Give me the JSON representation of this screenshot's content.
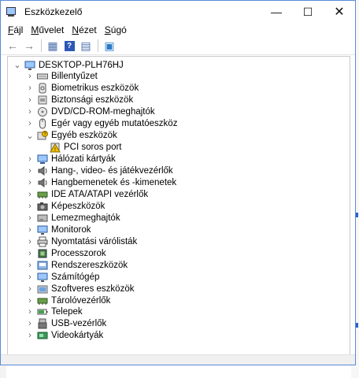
{
  "window": {
    "title": "Eszközkezelő",
    "controls": {
      "minimize": "—",
      "maximize": "☐",
      "close": "✕"
    }
  },
  "menu": [
    {
      "label": "Fájl",
      "accel": "F",
      "rest": "ájl"
    },
    {
      "label": "Művelet",
      "accel": "M",
      "rest": "űvelet"
    },
    {
      "label": "Nézet",
      "accel": "N",
      "rest": "ézet"
    },
    {
      "label": "Súgó",
      "accel": "S",
      "rest": "úgó"
    }
  ],
  "toolbar": [
    {
      "name": "back-icon",
      "glyph": "←",
      "color": "#7a7a7a"
    },
    {
      "name": "forward-icon",
      "glyph": "→",
      "color": "#7a7a7a"
    },
    {
      "name": "properties-icon",
      "glyph": "▦",
      "color": "#4a6ea9"
    },
    {
      "name": "help-icon",
      "glyph": "?",
      "color": "#2b57b5"
    },
    {
      "name": "view-icon",
      "glyph": "▤",
      "color": "#4a6ea9"
    },
    {
      "name": "scan-hardware-icon",
      "glyph": "▣",
      "color": "#2a7ac9"
    }
  ],
  "tree": {
    "root": "DESKTOP-PLH76HJ",
    "items": [
      {
        "label": "Billentyűzet",
        "icon": "keyboard-icon",
        "expanded": false
      },
      {
        "label": "Biometrikus eszközök",
        "icon": "fingerprint-icon",
        "expanded": false
      },
      {
        "label": "Biztonsági eszközök",
        "icon": "security-device-icon",
        "expanded": false
      },
      {
        "label": "DVD/CD-ROM-meghajtók",
        "icon": "dvd-drive-icon",
        "expanded": false
      },
      {
        "label": "Egér vagy egyéb mutatóeszköz",
        "icon": "mouse-icon",
        "expanded": false
      },
      {
        "label": "Egyéb eszközök",
        "icon": "unknown-device-icon",
        "expanded": true,
        "children": [
          {
            "label": "PCI soros port",
            "icon": "warning-device-icon"
          }
        ]
      },
      {
        "label": "Hálózati kártyák",
        "icon": "network-adapter-icon",
        "expanded": false
      },
      {
        "label": "Hang-, video- és játékvezérlők",
        "icon": "sound-icon",
        "expanded": false
      },
      {
        "label": "Hangbemenetek és -kimenetek",
        "icon": "audio-io-icon",
        "expanded": false
      },
      {
        "label": "IDE ATA/ATAPI vezérlők",
        "icon": "ide-controller-icon",
        "expanded": false
      },
      {
        "label": "Képeszközök",
        "icon": "camera-icon",
        "expanded": false
      },
      {
        "label": "Lemezmeghajtók",
        "icon": "disk-drive-icon",
        "expanded": false
      },
      {
        "label": "Monitorok",
        "icon": "monitor-icon",
        "expanded": false
      },
      {
        "label": "Nyomtatási várólisták",
        "icon": "printer-icon",
        "expanded": false
      },
      {
        "label": "Processzorok",
        "icon": "processor-icon",
        "expanded": false
      },
      {
        "label": "Rendszereszközök",
        "icon": "system-device-icon",
        "expanded": false
      },
      {
        "label": "Számítógép",
        "icon": "computer-icon",
        "expanded": false
      },
      {
        "label": "Szoftveres eszközök",
        "icon": "software-device-icon",
        "expanded": false
      },
      {
        "label": "Tárolóvezérlők",
        "icon": "storage-controller-icon",
        "expanded": false
      },
      {
        "label": "Telepek",
        "icon": "battery-icon",
        "expanded": false
      },
      {
        "label": "USB-vezérlők",
        "icon": "usb-icon",
        "expanded": false
      },
      {
        "label": "Videokártyák",
        "icon": "display-adapter-icon",
        "expanded": false
      }
    ]
  },
  "colors": {
    "accent": "#0078d7",
    "selection": "#e5f1fb",
    "icon_blue": "#3c7fd1",
    "warning": "#f2c200"
  }
}
